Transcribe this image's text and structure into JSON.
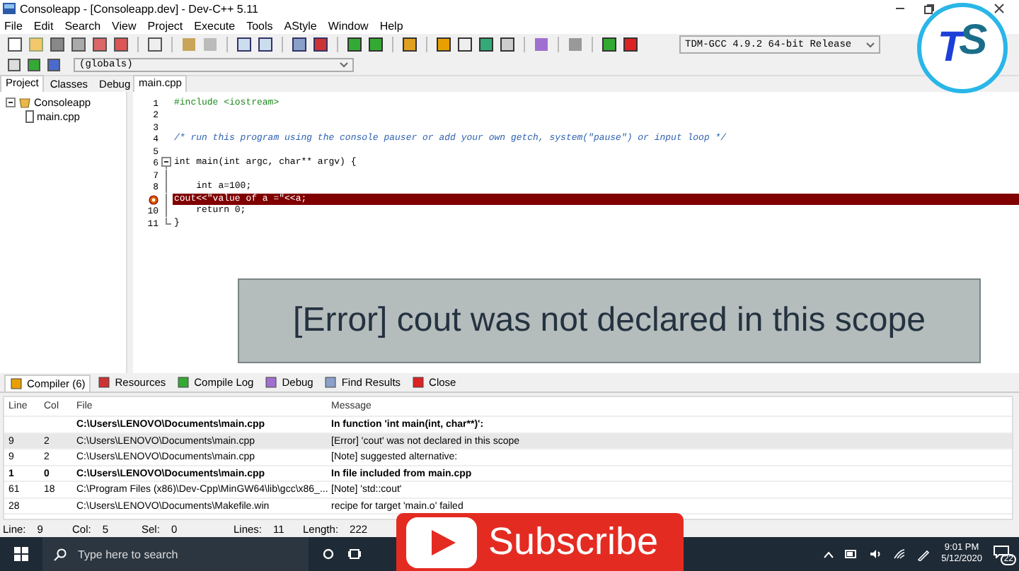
{
  "window": {
    "title": "Consoleapp - [Consoleapp.dev] - Dev-C++ 5.11"
  },
  "menu": [
    "File",
    "Edit",
    "Search",
    "View",
    "Project",
    "Execute",
    "Tools",
    "AStyle",
    "Window",
    "Help"
  ],
  "compiler_select": {
    "value": "TDM-GCC 4.9.2 64-bit Release"
  },
  "scope_select": {
    "value": "(globals)"
  },
  "side_tabs": [
    {
      "label": "Project",
      "selected": true
    },
    {
      "label": "Classes",
      "selected": false
    },
    {
      "label": "Debug",
      "selected": false
    }
  ],
  "project_tree": [
    {
      "label": "Consoleapp",
      "expanded": true,
      "children": [
        {
          "label": "main.cpp"
        }
      ]
    }
  ],
  "editor_tabs": [
    {
      "label": "main.cpp",
      "selected": true
    }
  ],
  "code_lines": [
    {
      "number": "1",
      "kind": "preprocessor",
      "text": "#include <iostream>",
      "error": false
    },
    {
      "number": "2",
      "error": false
    },
    {
      "number": "3",
      "error": false
    },
    {
      "number": "4",
      "kind": "comment",
      "text": "/* run this program using the console pauser or add your own getch, system(\"pause\") or input loop */",
      "error": false
    },
    {
      "number": "5",
      "error": false
    },
    {
      "number": "6",
      "kind": "code",
      "text": "int main(int argc, char** argv) {",
      "error": false,
      "fold_start": true
    },
    {
      "number": "7",
      "error": false
    },
    {
      "number": "8",
      "kind": "code",
      "text": "    int a=100;",
      "error": false
    },
    {
      "kind": "code",
      "text": "cout<<\"value of a =\"<<a;",
      "error": true
    },
    {
      "number": "10",
      "kind": "code",
      "text": "    return 0;",
      "error": false
    },
    {
      "number": "11",
      "kind": "code",
      "text": "}",
      "error": false,
      "fold_end": true
    }
  ],
  "banner": {
    "text": "[Error] cout was not declared in this scope"
  },
  "bottom_tabs": [
    {
      "label": "Compiler (6)",
      "selected": true
    },
    {
      "label": "Resources",
      "selected": false
    },
    {
      "label": "Compile Log",
      "selected": false
    },
    {
      "label": "Debug",
      "selected": false
    },
    {
      "label": "Find Results",
      "selected": false
    },
    {
      "label": "Close",
      "selected": false
    }
  ],
  "messages": {
    "columns": [
      "Line",
      "Col",
      "File",
      "Message"
    ],
    "rows": [
      {
        "file": "C:\\Users\\LENOVO\\Documents\\main.cpp",
        "message": "In function 'int main(int, char**)':",
        "bold": true,
        "selected": false
      },
      {
        "line": "9",
        "col": "2",
        "file": "C:\\Users\\LENOVO\\Documents\\main.cpp",
        "message": "[Error] 'cout' was not declared in this scope",
        "bold": false,
        "selected": true
      },
      {
        "line": "9",
        "col": "2",
        "file": "C:\\Users\\LENOVO\\Documents\\main.cpp",
        "message": "[Note] suggested alternative:",
        "bold": false,
        "selected": false
      },
      {
        "line": "1",
        "col": "0",
        "file": "C:\\Users\\LENOVO\\Documents\\main.cpp",
        "message": "In file included from main.cpp",
        "bold": true,
        "selected": false
      },
      {
        "line": "61",
        "col": "18",
        "file": "C:\\Program Files (x86)\\Dev-Cpp\\MinGW64\\lib\\gcc\\x86_...",
        "message": "[Note] 'std::cout'",
        "bold": false,
        "selected": false
      },
      {
        "line": "28",
        "file": "C:\\Users\\LENOVO\\Documents\\Makefile.win",
        "message": "recipe for target 'main.o' failed",
        "bold": false,
        "selected": false
      }
    ]
  },
  "status_bar": [
    {
      "label": "Line:",
      "value": "9"
    },
    {
      "label": "Col:",
      "value": "5"
    },
    {
      "label": "Sel:",
      "value": "0"
    },
    {
      "label": "Lines:",
      "value": "11"
    },
    {
      "label": "Length:",
      "value": "222"
    }
  ],
  "taskbar": {
    "search_placeholder": "Type here to search",
    "time": "9:01 PM",
    "date": "5/12/2020",
    "notifications": "22"
  },
  "subscribe": {
    "label": "Subscribe"
  },
  "logo": {
    "letters": [
      "T",
      "S"
    ]
  }
}
